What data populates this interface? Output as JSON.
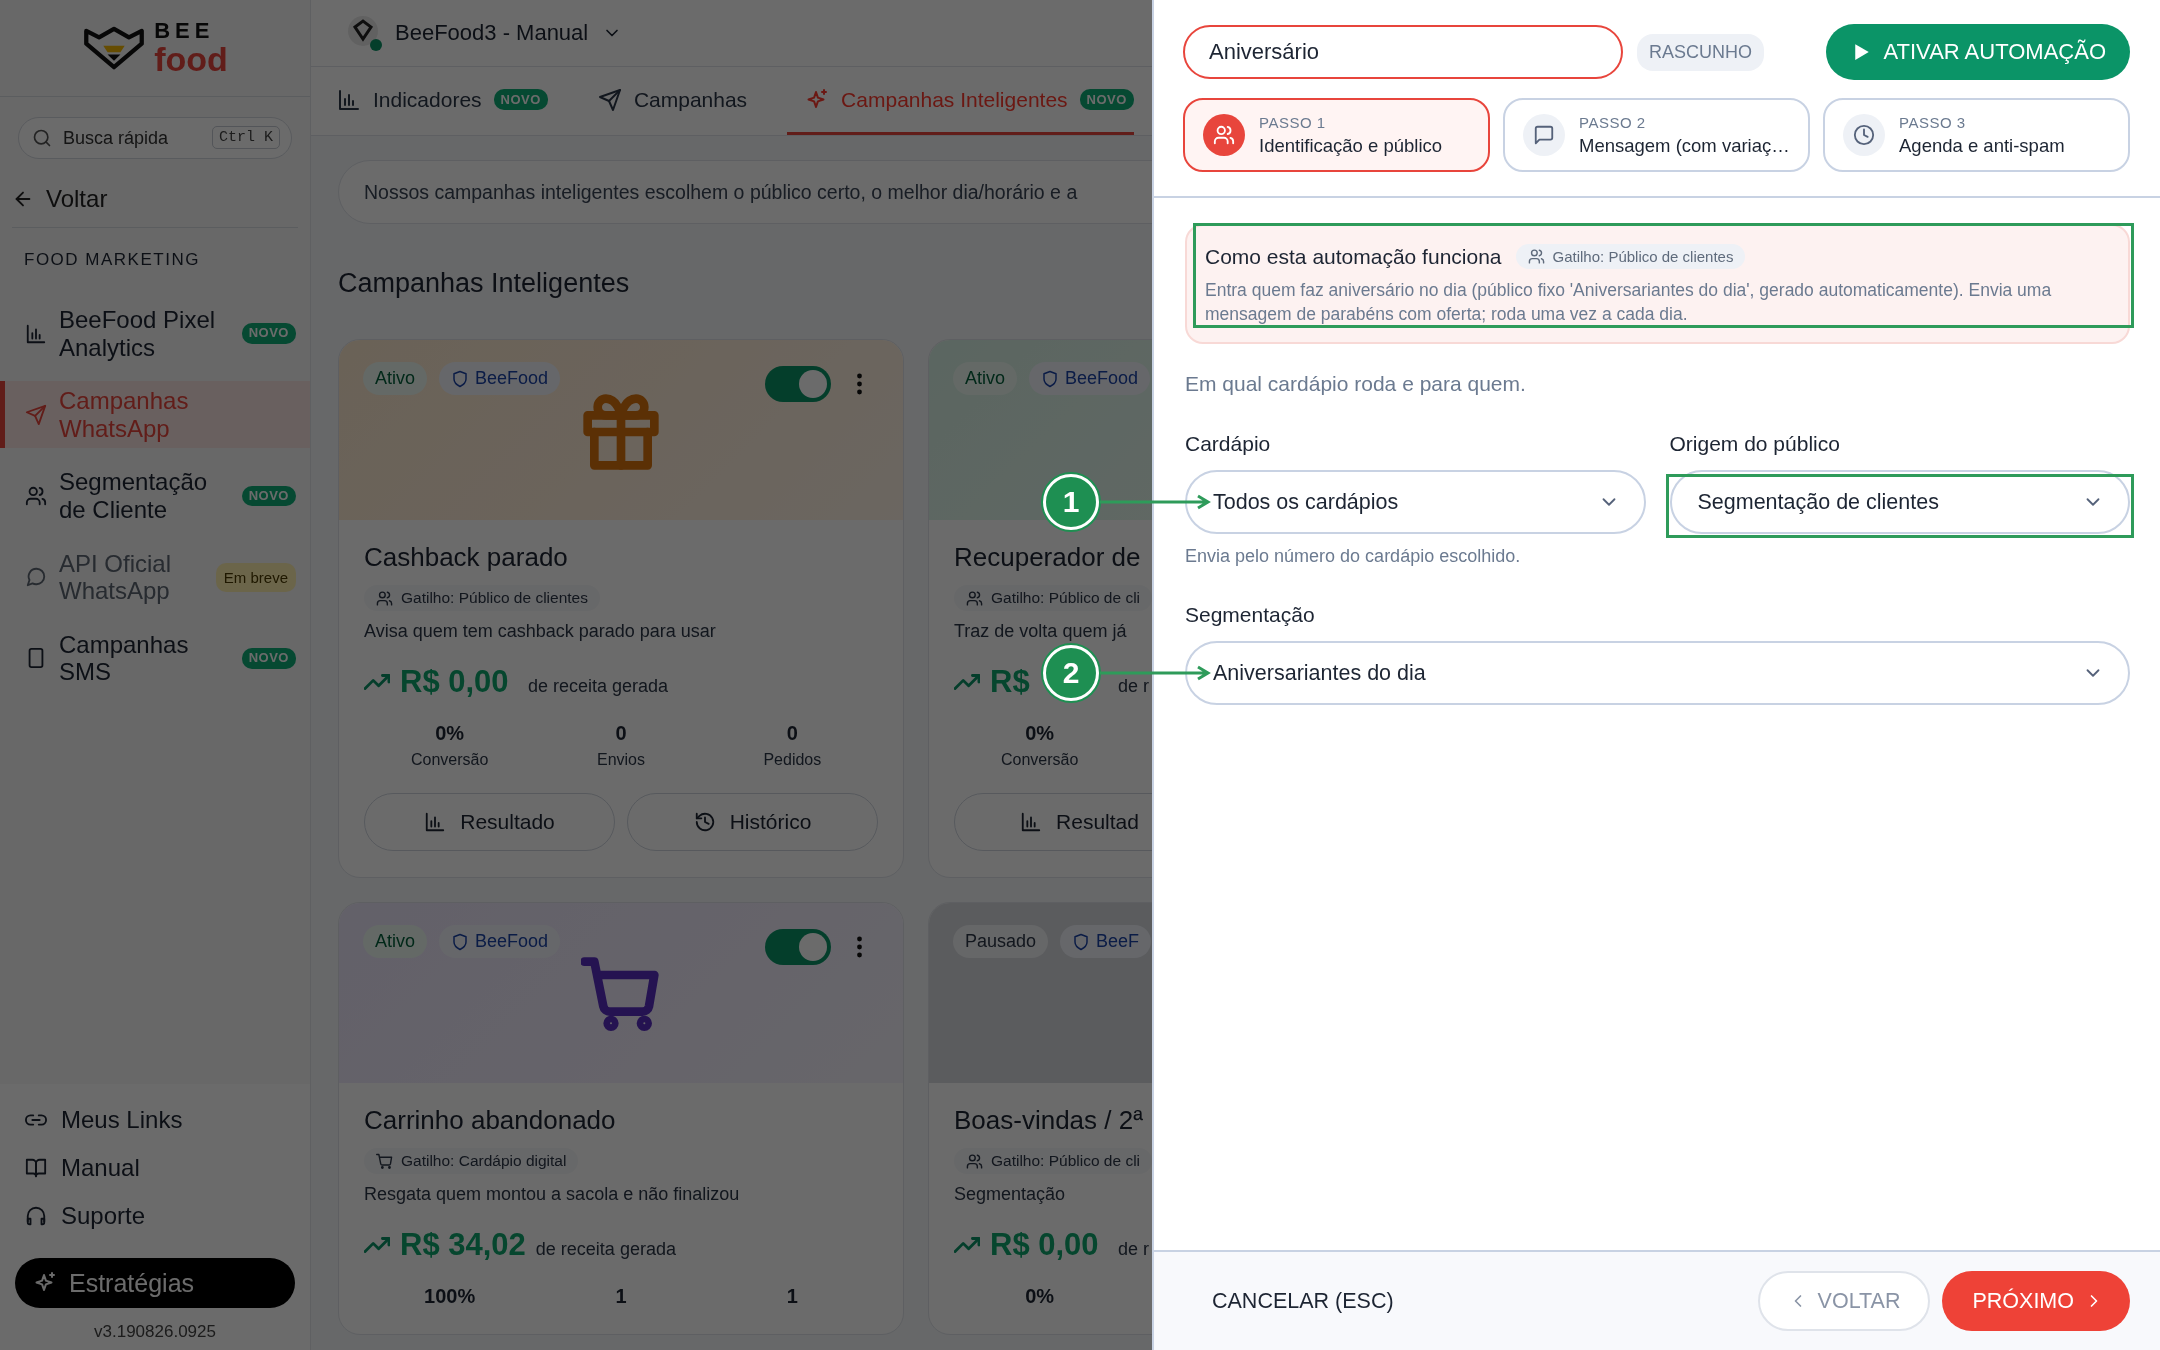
{
  "sidebar": {
    "logo": {
      "line_1": "BEE",
      "line_2": "food"
    },
    "search": {
      "placeholder": "Busca rápida",
      "shortcut": "Ctrl K"
    },
    "back": "Voltar",
    "section": "FOOD MARKETING",
    "items": [
      {
        "label": "BeeFood Pixel Analytics",
        "badge": "NOVO",
        "selected": false,
        "disabled": false
      },
      {
        "label": "Campanhas WhatsApp",
        "selected": true,
        "disabled": false
      },
      {
        "label": "Segmentação de Cliente",
        "badge": "NOVO",
        "selected": false,
        "disabled": false
      },
      {
        "label": "API Oficial WhatsApp",
        "badge": "Em breve",
        "selected": false,
        "disabled": true
      },
      {
        "label": "Campanhas SMS",
        "badge": "NOVO",
        "selected": false,
        "disabled": false
      }
    ],
    "footer_links": [
      "Meus Links",
      "Manual",
      "Suporte"
    ],
    "strategies_button": "Estratégias",
    "version": "v3.190826.0925"
  },
  "header": {
    "workspace": "BeeFood3 - Manual"
  },
  "tabs": [
    {
      "label": "Indicadores",
      "badge": "NOVO",
      "selected": false
    },
    {
      "label": "Campanhas",
      "selected": false
    },
    {
      "label": "Campanhas Inteligentes",
      "badge": "NOVO",
      "selected": true
    }
  ],
  "banner": "Nossos campanhas inteligentes escolhem o público certo, o melhor dia/horário e a",
  "heading": "Campanhas Inteligentes",
  "cards": [
    {
      "status": "Ativo",
      "active": true,
      "brand": "BeeFood",
      "toggle_on": true,
      "title": "Cashback parado",
      "trigger": "Gatilho: Público de clientes",
      "description": "Avisa quem tem cashback parado para usar",
      "revenue": "R$ 0,00",
      "revenue_label": "de receita gerada",
      "stats": [
        {
          "value": "0%",
          "label": "Conversão"
        },
        {
          "value": "0",
          "label": "Envios"
        },
        {
          "value": "0",
          "label": "Pedidos"
        }
      ],
      "actions": [
        "Resultado",
        "Histórico"
      ]
    },
    {
      "status": "Ativo",
      "active": true,
      "brand": "BeeFood",
      "title": "Recuperador de",
      "trigger": "Gatilho: Público de cli",
      "description": "Traz de volta quem já",
      "revenue": "R$",
      "revenue_label": "de r",
      "stats": [
        {
          "value": "0%",
          "label": "Conversão"
        }
      ],
      "actions": [
        "Resultad"
      ]
    },
    {
      "status": "Ativo",
      "active": true,
      "brand": "BeeFood",
      "toggle_on": true,
      "title": "Carrinho abandonado",
      "trigger": "Gatilho: Cardápio digital",
      "description": "Resgata quem montou a sacola e não finalizou",
      "revenue": "R$ 34,02",
      "revenue_label": "de receita gerada",
      "stats": [
        {
          "value": "100%"
        },
        {
          "value": "1"
        },
        {
          "value": "1"
        }
      ]
    },
    {
      "status": "Pausado",
      "active": false,
      "brand": "BeeF",
      "title": "Boas-vindas / 2ª",
      "trigger": "Gatilho: Público de cli",
      "description": "Segmentação",
      "revenue": "R$ 0,00",
      "revenue_label": "de r",
      "stats": [
        {
          "value": "0%"
        }
      ]
    }
  ],
  "panel": {
    "name_field": {
      "value": "Aniversário"
    },
    "status": "RASCUNHO",
    "activate_button": "ATIVAR AUTOMAÇÃO",
    "steps": [
      {
        "step": "PASSO 1",
        "label": "Identificação e público",
        "selected": true
      },
      {
        "step": "PASSO 2",
        "label": "Mensagem (com variaç…",
        "selected": false
      },
      {
        "step": "PASSO 3",
        "label": "Agenda e anti-spam",
        "selected": false
      }
    ],
    "info": {
      "title": "Como esta automação funciona",
      "trigger": "Gatilho: Público de clientes",
      "text": "Entra quem faz aniversário no dia (público fixo 'Aniversariantes do dia', gerado automaticamente). Envia uma mensagem de parabéns com oferta; roda uma vez a cada dia.",
      "highlighted": true
    },
    "intro": "Em qual cardápio roda e para quem.",
    "field_rows": [
      {
        "fields": [
          {
            "label": "Cardápio",
            "value": "Todos os cardápios",
            "hint": "Envia pelo número do cardápio escolhido.",
            "marker": "1",
            "highlighted": false
          },
          {
            "label": "Origem do público",
            "value": "Segmentação de clientes",
            "highlighted": true
          }
        ]
      },
      {
        "fields": [
          {
            "label": "Segmentação",
            "value": "Aniversariantes do dia",
            "marker": "2",
            "highlighted": false
          }
        ]
      }
    ],
    "footer": {
      "cancel": "CANCELAR (ESC)",
      "back": "VOLTAR",
      "next": "PRÓXIMO"
    }
  }
}
